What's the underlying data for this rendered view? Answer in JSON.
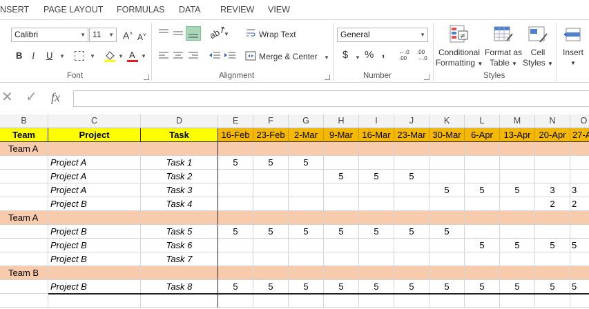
{
  "ribbon_tabs": [
    "NSERT",
    "PAGE LAYOUT",
    "FORMULAS",
    "DATA",
    "REVIEW",
    "VIEW"
  ],
  "font": {
    "name": "Calibri",
    "size": "11",
    "group_label": "Font",
    "bold": "B",
    "italic": "I",
    "underline": "U",
    "grow_icon": "A-increase-icon",
    "shrink_icon": "A-decrease-icon"
  },
  "alignment": {
    "wrap_text": "Wrap Text",
    "merge_center": "Merge & Center",
    "group_label": "Alignment"
  },
  "number": {
    "format": "General",
    "currency": "$",
    "percent": "%",
    "comma": ",",
    "group_label": "Number"
  },
  "styles": {
    "conditional": [
      "Conditional",
      "Formatting"
    ],
    "format_table": [
      "Format as",
      "Table"
    ],
    "cell_styles": [
      "Cell",
      "Styles"
    ],
    "group_label": "Styles"
  },
  "cells_group": {
    "insert": "Insert"
  },
  "formula_bar": {
    "fx": "fx",
    "value": ""
  },
  "sheet": {
    "column_letters": [
      "B",
      "C",
      "D",
      "E",
      "F",
      "G",
      "H",
      "I",
      "J",
      "K",
      "L",
      "M",
      "N",
      "O"
    ],
    "header": {
      "team": "Team",
      "project": "Project",
      "task": "Task"
    },
    "weeks": [
      "16-Feb",
      "23-Feb",
      "2-Mar",
      "9-Mar",
      "16-Mar",
      "23-Mar",
      "30-Mar",
      "6-Apr",
      "13-Apr",
      "20-Apr",
      "27-A"
    ],
    "rows": [
      {
        "type": "team",
        "team": "Team A"
      },
      {
        "type": "task",
        "project": "Project A",
        "task": "Task 1",
        "values": [
          "5",
          "5",
          "5",
          "",
          "",
          "",
          "",
          "",
          "",
          "",
          ""
        ]
      },
      {
        "type": "task",
        "project": "Project A",
        "task": "Task 2",
        "values": [
          "",
          "",
          "",
          "5",
          "5",
          "5",
          "",
          "",
          "",
          "",
          ""
        ]
      },
      {
        "type": "task",
        "project": "Project A",
        "task": "Task 3",
        "values": [
          "",
          "",
          "",
          "",
          "",
          "",
          "5",
          "5",
          "5",
          "3",
          "3"
        ]
      },
      {
        "type": "task",
        "project": "Project B",
        "task": "Task 4",
        "values": [
          "",
          "",
          "",
          "",
          "",
          "",
          "",
          "",
          "",
          "2",
          "2"
        ]
      },
      {
        "type": "team",
        "team": "Team A"
      },
      {
        "type": "task",
        "project": "Project B",
        "task": "Task 5",
        "values": [
          "5",
          "5",
          "5",
          "5",
          "5",
          "5",
          "5",
          "",
          "",
          "",
          ""
        ]
      },
      {
        "type": "task",
        "project": "Project B",
        "task": "Task 6",
        "values": [
          "",
          "",
          "",
          "",
          "",
          "",
          "",
          "5",
          "5",
          "5",
          "5"
        ]
      },
      {
        "type": "task",
        "project": "Project B",
        "task": "Task 7",
        "values": [
          "",
          "",
          "",
          "",
          "",
          "",
          "",
          "",
          "",
          "",
          ""
        ]
      },
      {
        "type": "team",
        "team": "Team B"
      },
      {
        "type": "task",
        "project": "Project B",
        "task": "Task 8",
        "values": [
          "5",
          "5",
          "5",
          "5",
          "5",
          "5",
          "5",
          "5",
          "5",
          "5",
          "5"
        ]
      },
      {
        "type": "empty"
      }
    ]
  },
  "colors": {
    "header_fill": "#ffff00",
    "week_fill": "#f5b800",
    "team_fill": "#f8cbad",
    "font_color_bar": "#e02020",
    "highlight_bar": "#ffff00",
    "active_align": "#a9d7b8"
  }
}
